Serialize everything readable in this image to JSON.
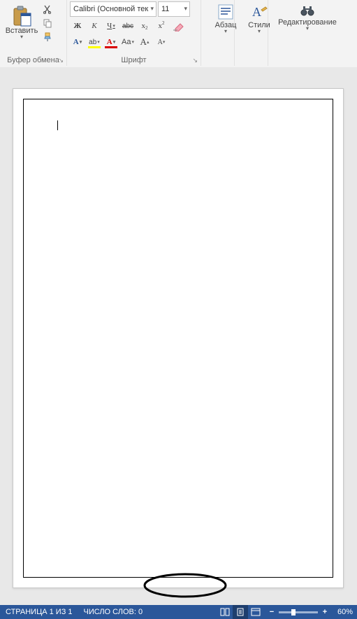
{
  "ribbon": {
    "clipboard": {
      "paste_label": "Вставить",
      "group_label": "Буфер обмена"
    },
    "font": {
      "font_name": "Calibri (Основной тек",
      "font_size": "11",
      "bold": "Ж",
      "italic": "К",
      "underline": "Ч",
      "strike": "abc",
      "x_base": "x",
      "sub": "2",
      "sup": "2",
      "text_effects": "A",
      "highlight": "ab",
      "font_color": "A",
      "change_case": "Aa",
      "grow_font": "A",
      "shrink_font": "A",
      "group_label": "Шрифт"
    },
    "paragraph": {
      "label": "Абзац"
    },
    "styles": {
      "label": "Стили"
    },
    "editing": {
      "label": "Редактирование"
    }
  },
  "status": {
    "page": "СТРАНИЦА 1 ИЗ 1",
    "words": "ЧИСЛО СЛОВ: 0",
    "zoom": "60%"
  }
}
